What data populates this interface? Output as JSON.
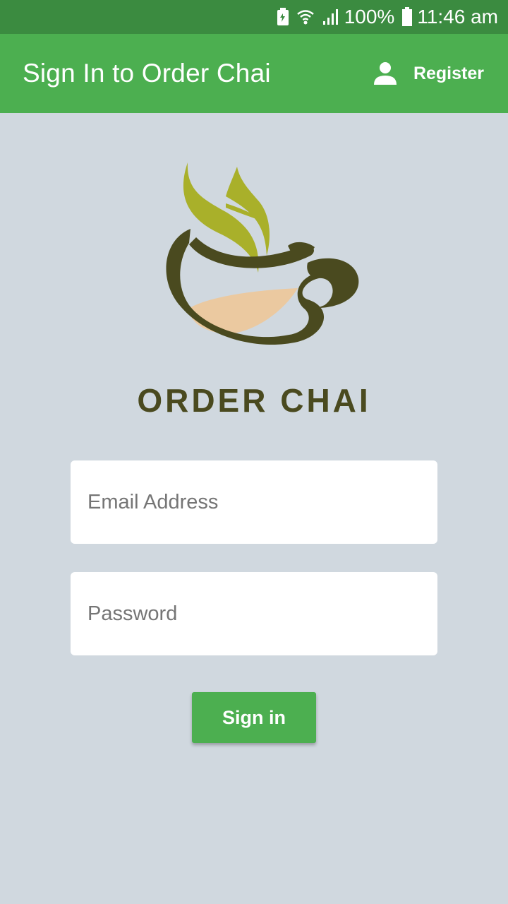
{
  "status_bar": {
    "battery_percent": "100%",
    "time": "11:46 am",
    "icons": [
      "battery-saver-icon",
      "wifi-icon",
      "signal-icon",
      "battery-icon"
    ]
  },
  "app_bar": {
    "title": "Sign In to Order Chai",
    "register_label": "Register",
    "register_icon": "person-icon",
    "color": "#4caf50"
  },
  "logo": {
    "text": "ORDER CHAI",
    "icon": "chai-cup-logo"
  },
  "form": {
    "email_placeholder": "Email Address",
    "email_value": "",
    "password_placeholder": "Password",
    "password_value": "",
    "submit_label": "Sign in"
  },
  "colors": {
    "status_bar": "#3b8b40",
    "accent": "#4caf50",
    "background": "#d0d8df",
    "logo_leaf": "#a9b02a",
    "logo_cup": "#4a4a1f",
    "logo_tea": "#ebc9a0"
  }
}
